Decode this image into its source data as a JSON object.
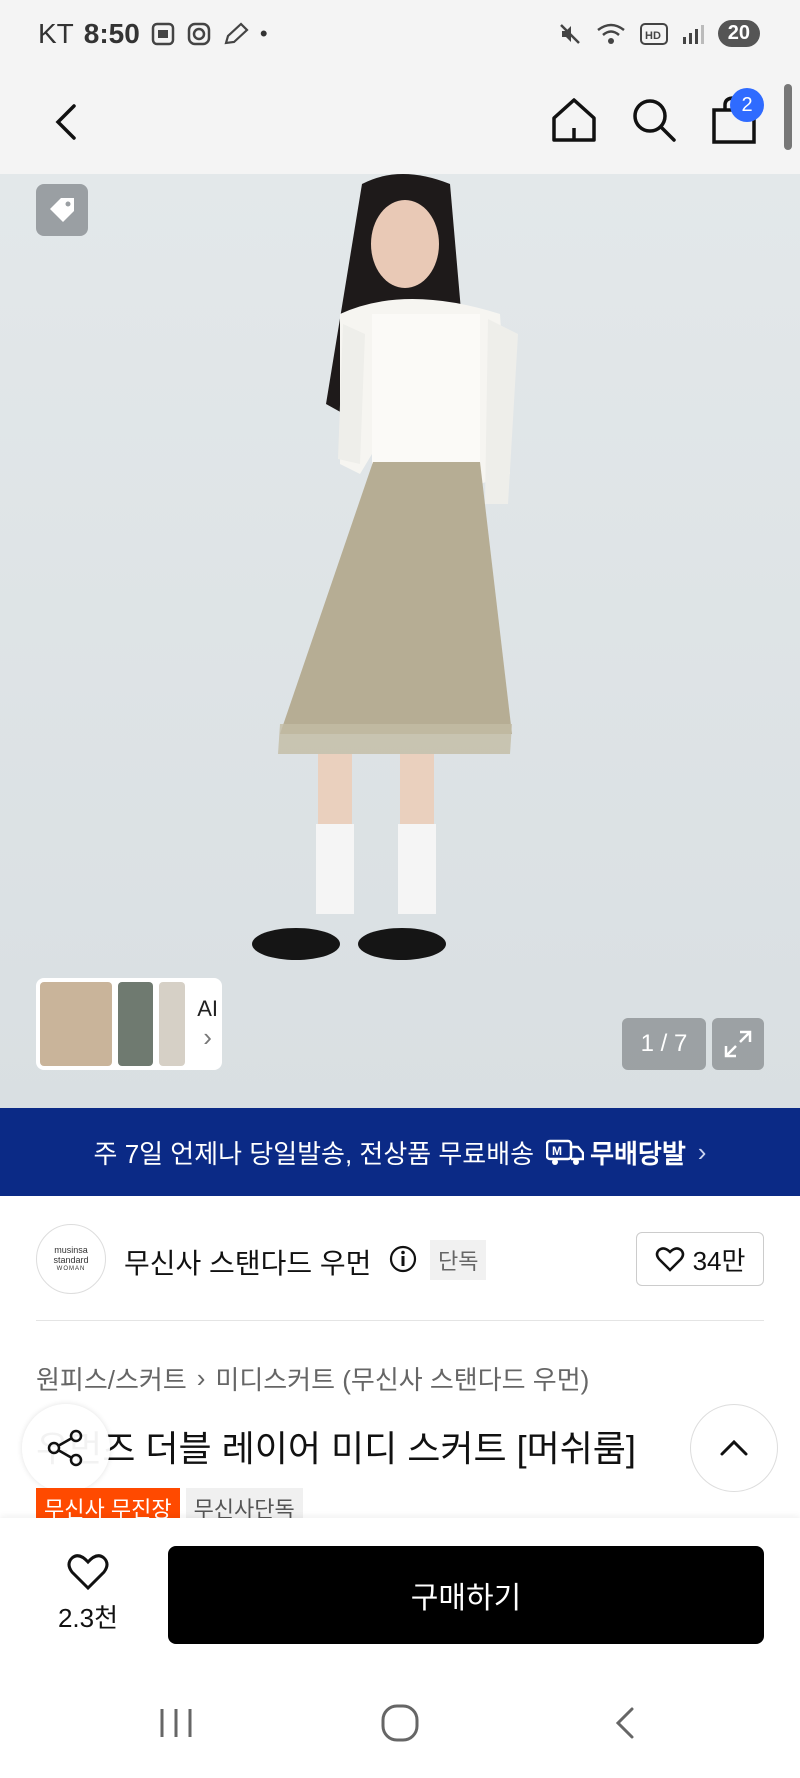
{
  "status_bar": {
    "carrier": "KT",
    "time": "8:50",
    "dot": "•",
    "battery": "20"
  },
  "header": {
    "cart_count": "2"
  },
  "gallery": {
    "page_indicator": "1 / 7",
    "ai_label": "AI",
    "ai_chevron": "›"
  },
  "shipping_banner": {
    "text": "주 7일 언제나 당일발송, 전상품 무료배송",
    "badge_letter": "M",
    "badge": "무배당발",
    "chevron": "›"
  },
  "brand": {
    "logo_line1": "musinsa",
    "logo_line2": "standard",
    "logo_line3": "WOMAN",
    "name": "무신사 스탠다드 우먼",
    "exclusive": "단독",
    "likes": "34만"
  },
  "breadcrumb": {
    "category": "원피스/스커트",
    "separator": "›",
    "subcategory": "미디스커트 (무신사 스탠다드 우먼)"
  },
  "product": {
    "title": "우먼즈 더블 레이어 미디 스커트 [머쉬룸]",
    "tags": [
      "무신사 무진장",
      "무신사단독"
    ]
  },
  "buy_bar": {
    "wish_count": "2.3천",
    "buy_label": "구매하기"
  },
  "colors": {
    "banner": "#0b2a86",
    "badge_blue": "#2f6bff",
    "tag_red": "#ff4a00",
    "buy_button": "#000000"
  }
}
